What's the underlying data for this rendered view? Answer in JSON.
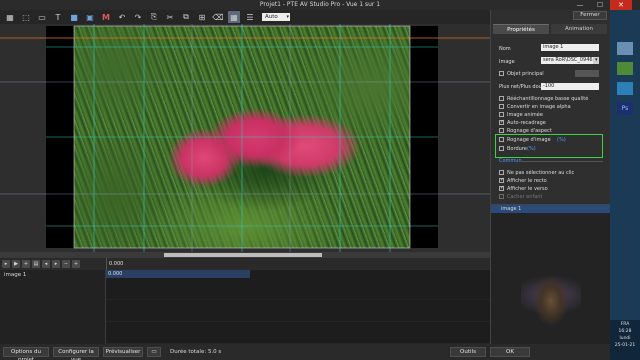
{
  "window": {
    "title": "Projet1 - PTE AV Studio Pro - Vue 1 sur 1",
    "min": "—",
    "max": "☐",
    "close": "✕"
  },
  "toolbar": {
    "zoom_value": "Auto"
  },
  "timeline": {
    "ruler_time": "0.000",
    "track_label": "image 1",
    "clip_time": "0.000"
  },
  "bottom": {
    "options_projet": "Options du projet",
    "configurer_vue": "Configurer la vue",
    "previsualiser": "Prévisualiser",
    "duree": "Durée totale: 5.0 s",
    "outils": "Outils",
    "ok": "OK"
  },
  "panel": {
    "fermer": "Fermer",
    "tab_proprietes": "Propriétés",
    "tab_animation": "Animation",
    "nom_label": "Nom",
    "nom_value": "image 1",
    "image_label": "Image",
    "image_value": "sera RoR\\DSC_0946.jpg",
    "objet_principal": "Objet principal",
    "plusnet_label": "Plus net/Plus dou...",
    "plusnet_value": "-100",
    "cb_rechant": "Rééchantillonnage basse qualité",
    "cb_convertir": "Convertir en image alpha",
    "cb_animee": "Image animée",
    "cb_auto": "Auto-recadrage",
    "cb_rognage_aspect": "Rognage d'aspect",
    "cb_rognage_image": "Rognage d'image",
    "rognage_pct": "(%)",
    "cb_bordure": "Bordure",
    "bordure_pct": "(%)",
    "section_commun": "Commun",
    "cb_ne_pas": "Ne pas sélectionner au clic",
    "cb_recto": "Afficher le recto",
    "cb_verso": "Afficher le verso",
    "cb_cacher": "Cacher enfant",
    "obj_item": "image 1"
  },
  "tray": {
    "lang": "FRA",
    "time": "16:28",
    "day": "lundi",
    "date": "25-01-21"
  },
  "colors": {
    "highlight_box": "#3fd247",
    "section_blue": "#4aa3ff",
    "close_red": "#c42b1c",
    "guide_cyan": "#34c6b6",
    "guide_orange": "#e0731e"
  },
  "icons": [
    "grid-icon",
    "select-icon",
    "frame-icon",
    "text-icon",
    "rectangle-icon",
    "image-icon",
    "video-icon",
    "undo-icon",
    "redo-icon",
    "cut-icon",
    "copy-icon",
    "paste-icon",
    "delete-icon",
    "mask-icon",
    "fit-icon",
    "snap-icon"
  ]
}
